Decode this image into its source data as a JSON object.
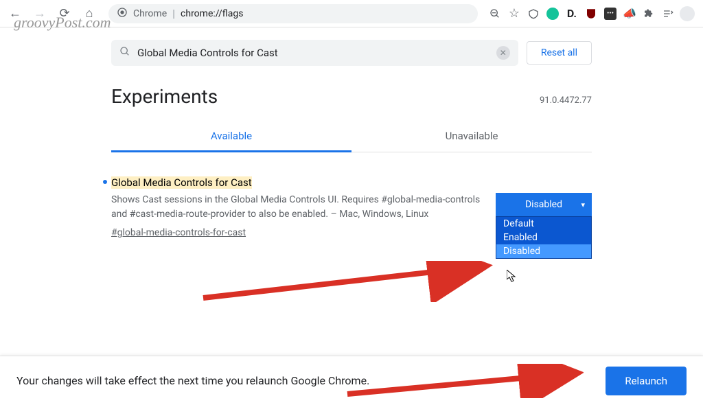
{
  "browser": {
    "url_host": "Chrome",
    "url_path": "chrome://flags"
  },
  "watermark": "groovyPost.com",
  "search": {
    "value": "Global Media Controls for Cast",
    "reset_label": "Reset all"
  },
  "header": {
    "title": "Experiments",
    "version": "91.0.4472.77"
  },
  "tabs": [
    {
      "label": "Available",
      "active": true
    },
    {
      "label": "Unavailable",
      "active": false
    }
  ],
  "flag": {
    "title": "Global Media Controls for Cast",
    "description": "Shows Cast sessions in the Global Media Controls UI. Requires #global-media-controls and #cast-media-route-provider to also be enabled. – Mac, Windows, Linux",
    "hash": "#global-media-controls-for-cast",
    "selected": "Disabled",
    "options": [
      "Default",
      "Enabled",
      "Disabled"
    ]
  },
  "footer": {
    "message": "Your changes will take effect the next time you relaunch Google Chrome.",
    "button": "Relaunch"
  },
  "icons": {
    "chrome_brand": "◉",
    "search": "search",
    "star": "☆",
    "zoom": "⊖"
  }
}
